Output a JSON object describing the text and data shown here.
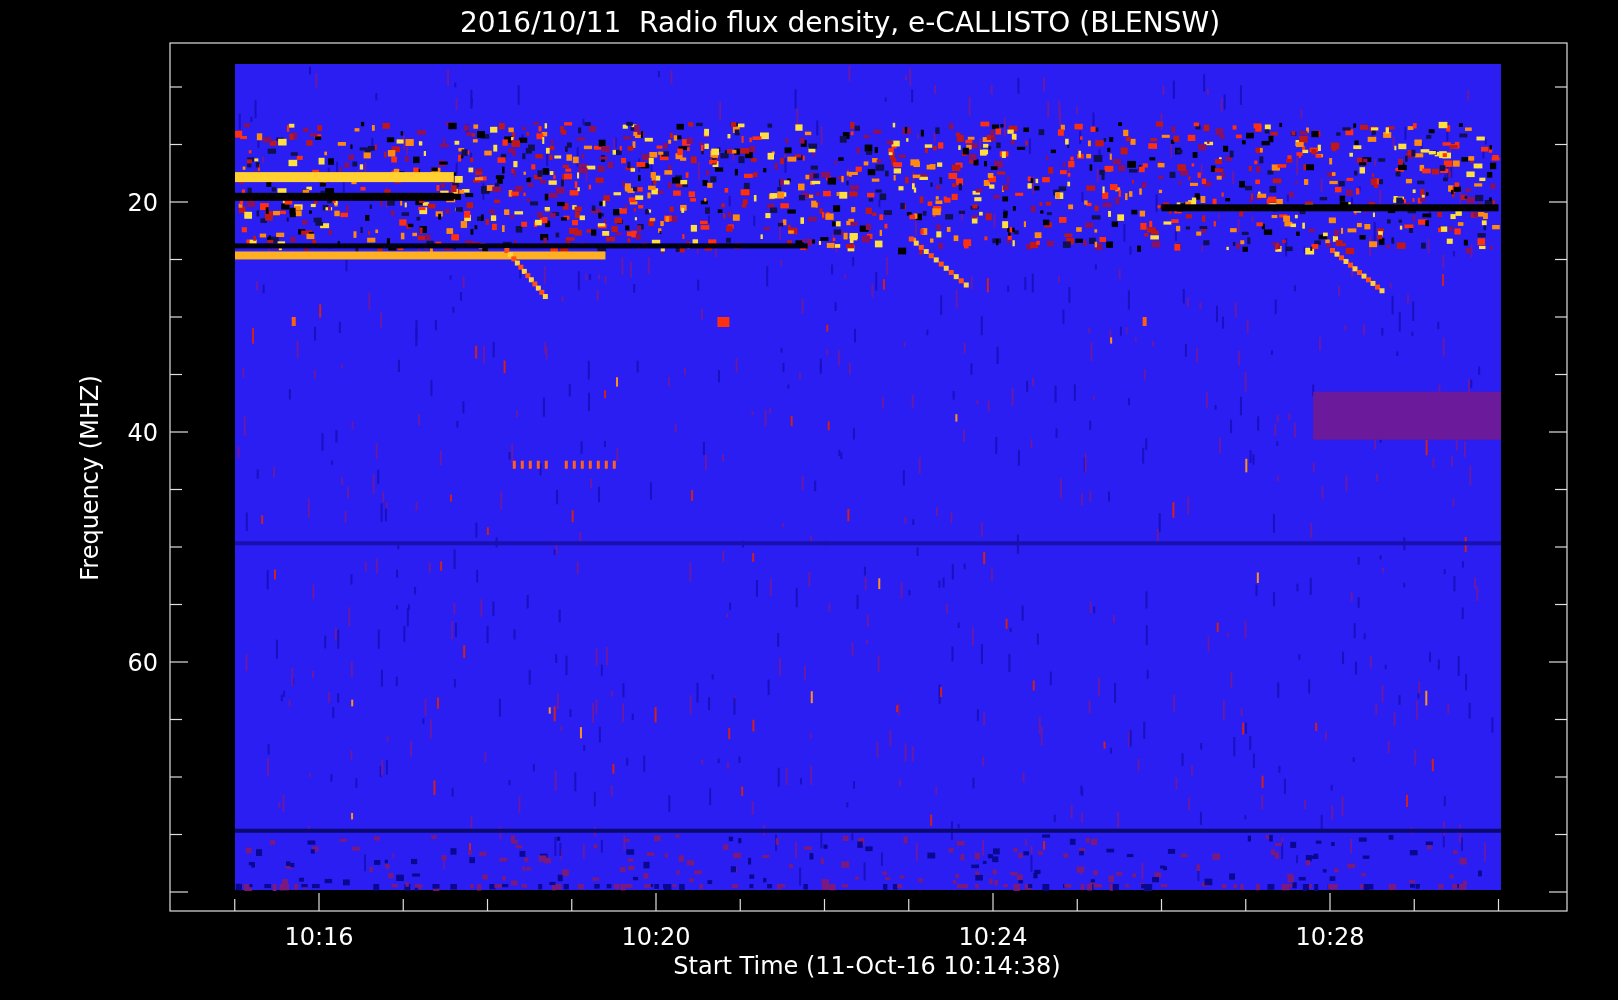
{
  "title": "2016/10/11  Radio flux density, e-CALLISTO (BLENSW)",
  "y_axis": {
    "label": "Frequency (MHZ)",
    "ticks": [
      "20",
      "40",
      "60"
    ]
  },
  "x_axis": {
    "label": "Start Time (11-Oct-16 10:14:38)",
    "ticks": [
      "10:16",
      "10:20",
      "10:24",
      "10:28"
    ]
  }
}
